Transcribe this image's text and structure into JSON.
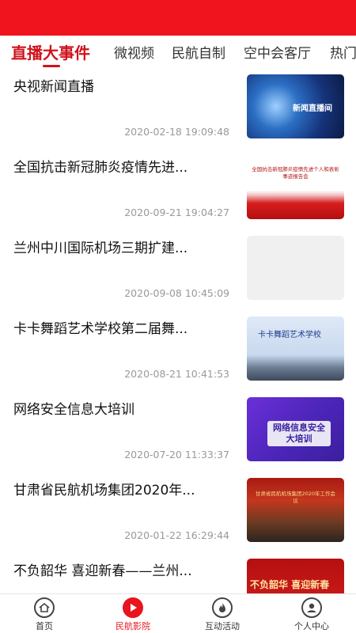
{
  "tabs": [
    {
      "label": "直播大事件",
      "active": true
    },
    {
      "label": "微视频",
      "active": false
    },
    {
      "label": "民航自制",
      "active": false
    },
    {
      "label": "空中会客厅",
      "active": false
    },
    {
      "label": "热门",
      "active": false
    }
  ],
  "items": [
    {
      "title": "央视新闻直播",
      "time": "2020-02-18 19:09:48",
      "thumb_text": "新闻直播间"
    },
    {
      "title": "全国抗击新冠肺炎疫情先进...",
      "time": "2020-09-21 19:04:27",
      "thumb_text": "全国抗击新冠肺炎疫情先进个人和表彰事迹报告会"
    },
    {
      "title": "兰州中川国际机场三期扩建...",
      "time": "2020-09-08 10:45:09",
      "thumb_text": ""
    },
    {
      "title": "卡卡舞蹈艺术学校第二届舞...",
      "time": "2020-08-21 10:41:53",
      "thumb_text": "卡卡舞蹈艺术学校"
    },
    {
      "title": "网络安全信息大培训",
      "time": "2020-07-20 11:33:37",
      "thumb_text": "网络信息安全大培训"
    },
    {
      "title": "甘肃省民航机场集团2020年...",
      "time": "2020-01-22 16:29:44",
      "thumb_text": "甘肃省民航机场集团2020年工作会议"
    },
    {
      "title": "不负韶华 喜迎新春——兰州...",
      "time": "",
      "thumb_text": "不负韶华 喜迎新春"
    }
  ],
  "bottom_nav": [
    {
      "label": "首页",
      "icon": "home-icon",
      "active": false
    },
    {
      "label": "民航影院",
      "icon": "play-icon",
      "active": true
    },
    {
      "label": "互动活动",
      "icon": "fire-icon",
      "active": false
    },
    {
      "label": "个人中心",
      "icon": "user-icon",
      "active": false
    }
  ],
  "colors": {
    "accent": "#e8151f",
    "status_bar": "#f0141e"
  }
}
